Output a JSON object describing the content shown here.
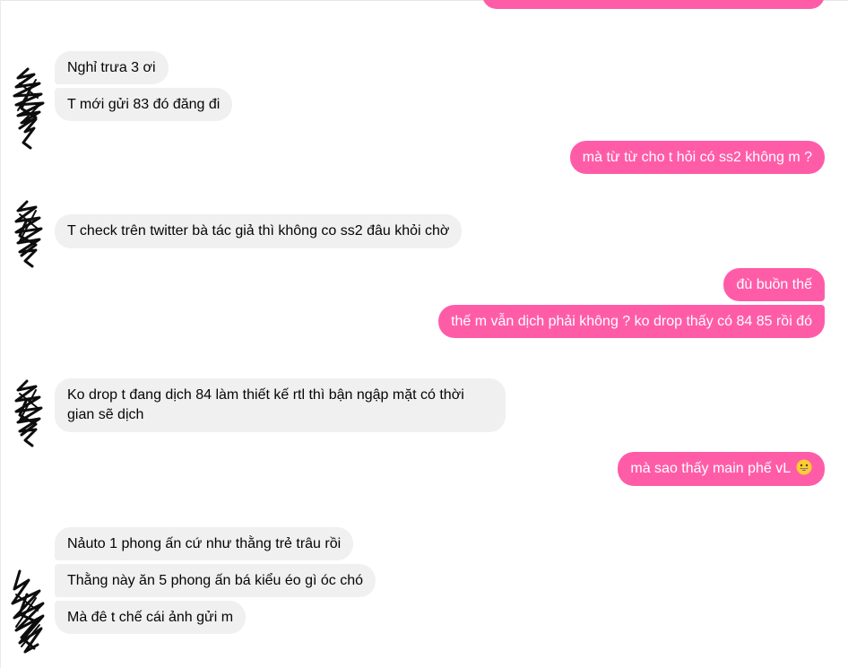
{
  "conversation": {
    "partial_top_message": "",
    "groups": [
      {
        "sender": "other",
        "messages": [
          "Nghỉ trưa 3 ơi",
          "T mới gửi 83 đó đăng đi"
        ]
      },
      {
        "sender": "me",
        "messages": [
          "mà từ từ cho t hỏi có ss2 không m ?"
        ]
      },
      {
        "sender": "other",
        "messages": [
          "T check trên twitter bà tác giả thì không co ss2 đâu khỏi chờ"
        ]
      },
      {
        "sender": "me",
        "messages": [
          "đù buồn thế",
          "thế m vẫn dịch phải không ? ko drop thấy có 84 85 rồi đó"
        ]
      },
      {
        "sender": "other",
        "messages": [
          "Ko drop t đang dịch 84 làm thiết kế rtl thì bận ngập mặt có thời gian sẽ dịch"
        ]
      },
      {
        "sender": "me",
        "messages": [
          "mà sao thấy main phế vL"
        ],
        "emoji": "grinning-face-icon"
      },
      {
        "sender": "other",
        "messages": [
          "Nảuto 1 phong ấn cứ như thằng trẻ trâu rồi",
          "Thằng này ăn 5 phong ấn bá kiểu éo gì óc chó",
          "Mà đê t chế cái ảnh gửi m"
        ]
      }
    ]
  },
  "colors": {
    "outgoing_bubble": "#ff5ca8",
    "incoming_bubble": "#f0f0f0",
    "incoming_text": "#050505",
    "outgoing_text": "#ffffff",
    "avatar_scribble": "#0d0d0d"
  }
}
